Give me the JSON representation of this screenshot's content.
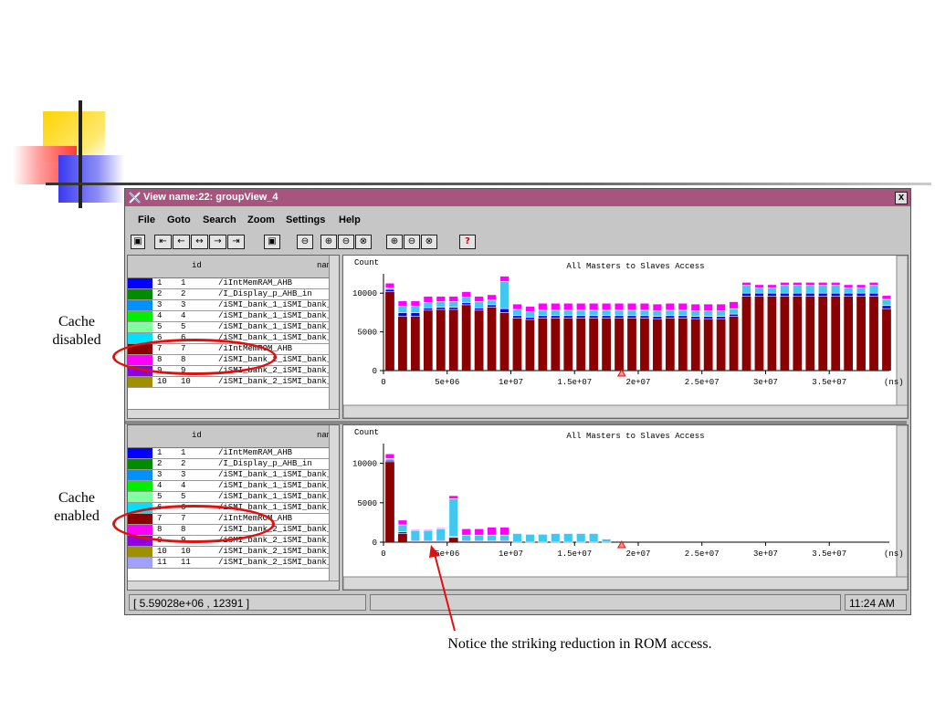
{
  "window": {
    "title": "View name:22: groupView_4",
    "close_label": "x",
    "menu": [
      "File",
      "Goto",
      "Search",
      "Zoom",
      "Settings",
      "Help"
    ],
    "toolbar": [
      "save-icon",
      "jump-start-icon",
      "step-back-icon",
      "fit-icon",
      "step-forward-icon",
      "jump-end-icon",
      "find-icon",
      "zoom-out-icon",
      "zoom-in-icon",
      "zoom-out-full-icon",
      "zoom-x-icon",
      "zoom-in-y-icon",
      "zoom-out-y-icon",
      "zoom-full-y-icon",
      "help-icon"
    ],
    "help_label": "?"
  },
  "list_header": {
    "id": "id",
    "name": "nam"
  },
  "top_list": [
    {
      "n": "1",
      "id": "1",
      "name": "/iIntMemRAM_AHB",
      "color": "#0000ff"
    },
    {
      "n": "2",
      "id": "2",
      "name": "/I_Display_p_AHB_in",
      "color": "#008a00"
    },
    {
      "n": "3",
      "id": "3",
      "name": "/iSMI_bank_1_iSMI_bank_",
      "color": "#0090ff"
    },
    {
      "n": "4",
      "id": "4",
      "name": "/iSMI_bank_1_iSMI_bank_",
      "color": "#00ee00"
    },
    {
      "n": "5",
      "id": "5",
      "name": "/iSMI_bank_1_iSMI_bank_",
      "color": "#80ffa0"
    },
    {
      "n": "6",
      "id": "6",
      "name": "/iSMI_bank_1_iSMI_bank_",
      "color": "#00e0ff"
    },
    {
      "n": "7",
      "id": "7",
      "name": "/iIntMemROM_AHB",
      "color": "#8a0000"
    },
    {
      "n": "8",
      "id": "8",
      "name": "/iSMI_bank_2_iSMI_bank_",
      "color": "#ff00ff"
    },
    {
      "n": "9",
      "id": "9",
      "name": "/iSMI_bank_2_iSMI_bank_",
      "color": "#9000e0"
    },
    {
      "n": "10",
      "id": "10",
      "name": "/iSMI_bank_2_iSMI_bank_",
      "color": "#a09000"
    }
  ],
  "bottom_list": [
    {
      "n": "1",
      "id": "1",
      "name": "/iIntMemRAM_AHB",
      "color": "#0000ff"
    },
    {
      "n": "2",
      "id": "2",
      "name": "/I_Display_p_AHB_in",
      "color": "#008a00"
    },
    {
      "n": "3",
      "id": "3",
      "name": "/iSMI_bank_1_iSMI_bank_",
      "color": "#0090ff"
    },
    {
      "n": "4",
      "id": "4",
      "name": "/iSMI_bank_1_iSMI_bank_",
      "color": "#00ee00"
    },
    {
      "n": "5",
      "id": "5",
      "name": "/iSMI_bank_1_iSMI_bank_",
      "color": "#80ffa0"
    },
    {
      "n": "6",
      "id": "6",
      "name": "/iSMI_bank_1_iSMI_bank_",
      "color": "#00e0ff"
    },
    {
      "n": "7",
      "id": "7",
      "name": "/iIntMemROM_AHB",
      "color": "#8a0000"
    },
    {
      "n": "8",
      "id": "8",
      "name": "/iSMI_bank_2_iSMI_bank_",
      "color": "#ff00ff"
    },
    {
      "n": "9",
      "id": "9",
      "name": "/iSMI_bank_2_iSMI_bank_",
      "color": "#9000e0"
    },
    {
      "n": "10",
      "id": "10",
      "name": "/iSMI_bank_2_iSMI_bank_",
      "color": "#a09000"
    },
    {
      "n": "11",
      "id": "11",
      "name": "/iSMI_bank_2_iSMI_bank_",
      "color": "#a0a0ff"
    }
  ],
  "status": {
    "coords": "[ 5.59028e+06 , 12391 ]",
    "time": "11:24 AM"
  },
  "notes": {
    "cache_disabled": [
      "Cache",
      "disabled"
    ],
    "cache_enabled": [
      "Cache",
      "enabled"
    ],
    "callout": "Notice the striking reduction in ROM access."
  },
  "chart_data": [
    {
      "type": "bar",
      "title": "All Masters to Slaves Access",
      "ylabel": "Count",
      "xunit": "(ns)",
      "xlim": [
        0,
        39000000
      ],
      "ylim": [
        0,
        12500
      ],
      "xticks": [
        {
          "v": 0,
          "l": "0"
        },
        {
          "v": 5000000,
          "l": "5e+06"
        },
        {
          "v": 10000000,
          "l": "1e+07"
        },
        {
          "v": 15000000,
          "l": "1.5e+07"
        },
        {
          "v": 20000000,
          "l": "2e+07"
        },
        {
          "v": 25000000,
          "l": "2.5e+07"
        },
        {
          "v": 30000000,
          "l": "3e+07"
        },
        {
          "v": 35000000,
          "l": "3.5e+07"
        }
      ],
      "yticks": [
        {
          "v": 0,
          "l": "0"
        },
        {
          "v": 5000,
          "l": "5000"
        },
        {
          "v": 10000,
          "l": "10000"
        }
      ],
      "bin_width": 1000000,
      "marker_x": 18700000,
      "series_colors": {
        "rom": "#8b0000",
        "ram": "#0000ff",
        "smi": "#40c8f0",
        "display": "#ff00ff"
      },
      "rom": [
        10200,
        7000,
        7000,
        7800,
        7900,
        7900,
        8500,
        7800,
        8200,
        7500,
        6800,
        6600,
        6800,
        6800,
        6800,
        6800,
        6800,
        6800,
        6800,
        6800,
        6800,
        6700,
        6800,
        6800,
        6700,
        6700,
        6700,
        7000,
        9600,
        9600,
        9600,
        9600,
        9600,
        9600,
        9600,
        9600,
        9600,
        9600,
        9600,
        8000
      ],
      "ram": [
        300,
        500,
        500,
        300,
        300,
        300,
        300,
        300,
        300,
        500,
        300,
        300,
        300,
        300,
        300,
        300,
        300,
        300,
        300,
        300,
        300,
        300,
        300,
        300,
        300,
        300,
        300,
        300,
        400,
        400,
        400,
        400,
        400,
        400,
        400,
        400,
        400,
        400,
        400,
        400
      ],
      "smi": [
        200,
        800,
        800,
        700,
        700,
        700,
        700,
        800,
        600,
        3500,
        800,
        700,
        700,
        700,
        700,
        700,
        700,
        700,
        700,
        700,
        700,
        700,
        700,
        700,
        700,
        700,
        700,
        700,
        1000,
        700,
        700,
        1000,
        1000,
        1000,
        1000,
        1000,
        700,
        700,
        1000,
        800
      ],
      "display": [
        600,
        700,
        700,
        800,
        700,
        700,
        700,
        700,
        700,
        700,
        700,
        700,
        900,
        900,
        900,
        900,
        900,
        900,
        900,
        900,
        900,
        900,
        900,
        900,
        900,
        900,
        900,
        900,
        400,
        400,
        400,
        400,
        400,
        400,
        400,
        400,
        400,
        400,
        400,
        500
      ]
    },
    {
      "type": "bar",
      "title": "All Masters to Slaves Access",
      "ylabel": "Count",
      "xunit": "(ns)",
      "xlim": [
        0,
        39000000
      ],
      "ylim": [
        0,
        12500
      ],
      "xticks": [
        {
          "v": 0,
          "l": "0"
        },
        {
          "v": 5000000,
          "l": "5e+06"
        },
        {
          "v": 10000000,
          "l": "1e+07"
        },
        {
          "v": 15000000,
          "l": "1.5e+07"
        },
        {
          "v": 20000000,
          "l": "2e+07"
        },
        {
          "v": 25000000,
          "l": "2.5e+07"
        },
        {
          "v": 30000000,
          "l": "3e+07"
        },
        {
          "v": 35000000,
          "l": "3.5e+07"
        }
      ],
      "yticks": [
        {
          "v": 0,
          "l": "0"
        },
        {
          "v": 5000,
          "l": "5000"
        },
        {
          "v": 10000,
          "l": "10000"
        }
      ],
      "bin_width": 1000000,
      "marker_x": 18700000,
      "series_colors": {
        "rom": "#8b0000",
        "ram": "#0000ff",
        "smi": "#40c8f0",
        "display": "#ff00ff"
      },
      "rom": [
        10200,
        1100,
        100,
        100,
        100,
        600,
        100,
        100,
        100,
        100,
        0,
        0,
        0,
        0,
        0,
        0,
        0,
        0,
        0,
        0,
        0,
        0,
        0,
        0,
        0,
        0,
        0,
        0,
        0,
        0,
        0,
        0,
        0,
        0,
        0,
        0,
        0,
        0,
        0,
        0
      ],
      "ram": [
        200,
        200,
        100,
        100,
        100,
        100,
        100,
        100,
        100,
        100,
        0,
        0,
        0,
        0,
        0,
        0,
        0,
        0,
        0,
        0,
        0,
        0,
        0,
        0,
        0,
        0,
        0,
        0,
        0,
        0,
        0,
        0,
        0,
        0,
        0,
        0,
        0,
        0,
        0,
        0
      ],
      "smi": [
        200,
        900,
        1300,
        1300,
        1500,
        4800,
        700,
        700,
        700,
        700,
        1100,
        1000,
        1000,
        1100,
        1100,
        1100,
        1100,
        400,
        0,
        0,
        0,
        0,
        0,
        0,
        0,
        0,
        0,
        0,
        0,
        0,
        0,
        0,
        0,
        0,
        0,
        0,
        0,
        0,
        0,
        0
      ],
      "display": [
        600,
        600,
        100,
        100,
        100,
        400,
        800,
        800,
        1000,
        1000,
        0,
        0,
        0,
        0,
        0,
        0,
        0,
        0,
        0,
        0,
        0,
        0,
        0,
        0,
        0,
        0,
        0,
        0,
        0,
        0,
        0,
        0,
        0,
        0,
        0,
        0,
        0,
        0,
        0,
        0
      ]
    }
  ]
}
